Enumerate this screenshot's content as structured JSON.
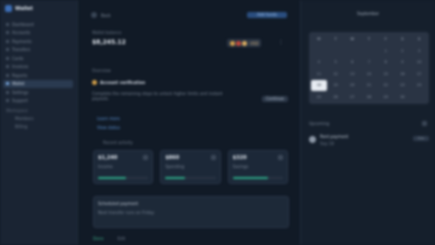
{
  "app": {
    "name": "Wallet"
  },
  "sidebar": {
    "items": [
      {
        "label": "Dashboard",
        "active": false
      },
      {
        "label": "Accounts",
        "active": false
      },
      {
        "label": "Payments",
        "active": false
      },
      {
        "label": "Transfers",
        "active": false
      },
      {
        "label": "Cards",
        "active": false
      },
      {
        "label": "Invoices",
        "active": false
      },
      {
        "label": "Reports",
        "active": false
      },
      {
        "label": "Wallet",
        "active": true
      },
      {
        "label": "Settings",
        "active": false
      },
      {
        "label": "Support",
        "active": false
      }
    ],
    "section": "Workspace",
    "sub_items": [
      "Members",
      "Billing"
    ]
  },
  "topbar": {
    "crumb": "Back",
    "action": "Add funds"
  },
  "header": {
    "eyebrow": "Wallet balance",
    "title": "$8,245.12",
    "chip_label": "USD",
    "chip_colors": [
      "#d6a24a",
      "#c9473a",
      "#e0b060"
    ]
  },
  "status": {
    "section": "Overview",
    "title": "Account verification",
    "description": "Complete the remaining steps to unlock higher limits and instant payouts.",
    "button": "Continue",
    "links": [
      "Learn more",
      "View status"
    ]
  },
  "cards": {
    "label": "Recent activity",
    "items": [
      {
        "value": "$1,240",
        "label": "Income",
        "progress": 0.55
      },
      {
        "value": "$860",
        "label": "Spending",
        "progress": 0.4
      },
      {
        "value": "$320",
        "label": "Savings",
        "progress": 0.7
      }
    ]
  },
  "note": {
    "title": "Scheduled payment",
    "text": "Next transfer runs on Friday"
  },
  "footer": {
    "primary": "Done",
    "secondary": "Edit"
  },
  "calendar": {
    "title": "September",
    "weekdays": [
      "M",
      "T",
      "W",
      "T",
      "F",
      "S",
      "S"
    ],
    "days": [
      "",
      "",
      "",
      "",
      "1",
      "2",
      "3",
      "4",
      "5",
      "6",
      "7",
      "8",
      "9",
      "10",
      "11",
      "12",
      "13",
      "14",
      "15",
      "16",
      "17",
      "18",
      "19",
      "20",
      "21",
      "22",
      "23",
      "24",
      "25",
      "26",
      "27",
      "28",
      "29",
      "30",
      ""
    ],
    "selected": "18"
  },
  "upcoming": {
    "label": "Upcoming",
    "event_title": "Rent payment",
    "event_sub": "Sep 18",
    "event_tag": "Due"
  }
}
